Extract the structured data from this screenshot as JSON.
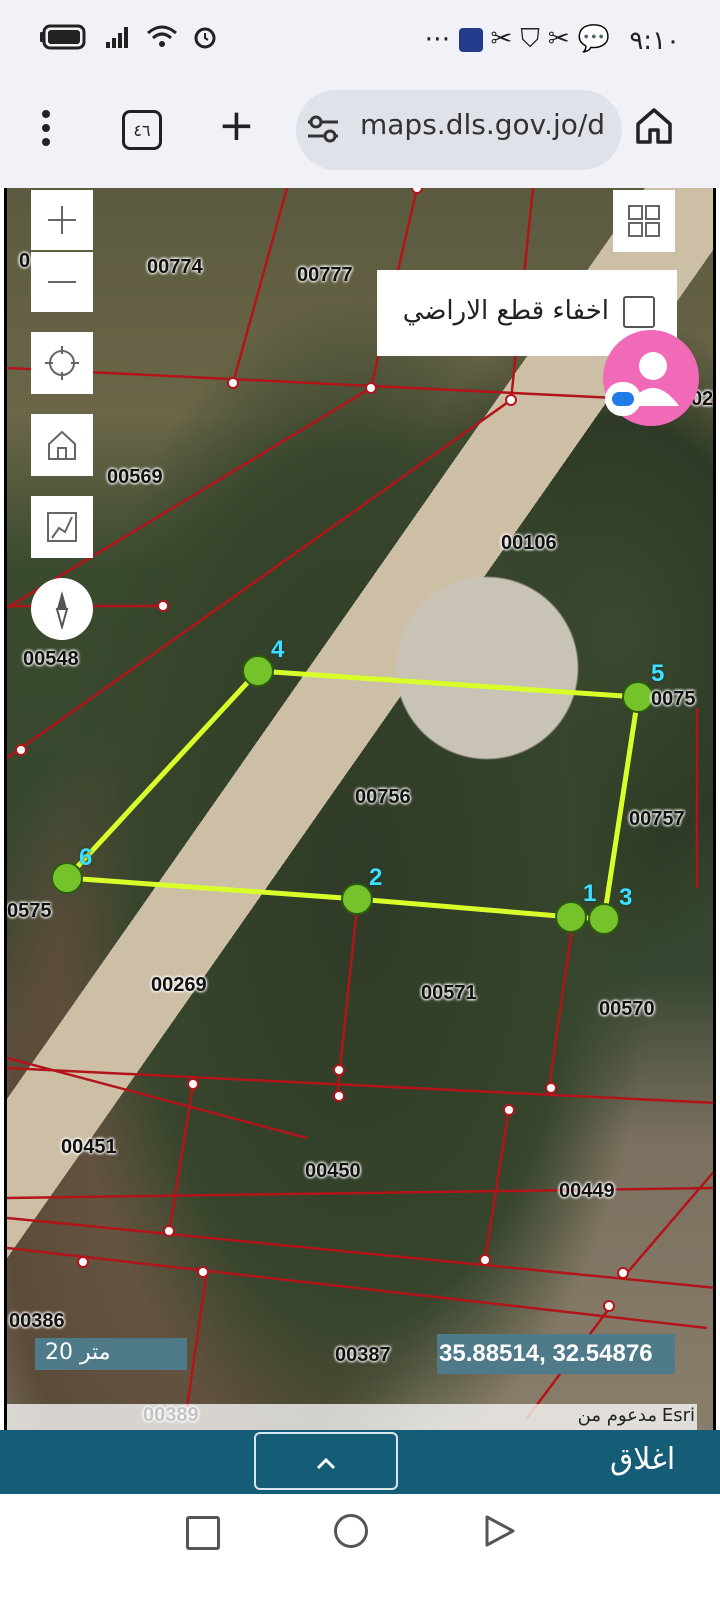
{
  "status_bar": {
    "time": "٩:١٠",
    "left_icons": [
      "battery-icon",
      "signal-icon",
      "wifi-icon",
      "alarm-icon"
    ],
    "right_icons": [
      "more-dots-icon",
      "app-icon",
      "tools-icon",
      "shield-icon",
      "tools-icon",
      "chat-icon"
    ]
  },
  "browser": {
    "tab_count": "٤٦",
    "url": "maps.dls.gov.jo/d"
  },
  "map": {
    "hide_parcels_label": "اخفاء قطع الاراضي",
    "coordinates": "35.88514, 32.54876",
    "scale_label": "20 متر",
    "attribution": "Esri",
    "attribution_prefix": "مدعوم من",
    "parcels": [
      {
        "id": "00774"
      },
      {
        "id": "00777"
      },
      {
        "id": "00569"
      },
      {
        "id": "00106"
      },
      {
        "id": "00548"
      },
      {
        "id": "00756"
      },
      {
        "id": "00757"
      },
      {
        "id": "0075"
      },
      {
        "id": "0575"
      },
      {
        "id": "00269"
      },
      {
        "id": "00571"
      },
      {
        "id": "00570"
      },
      {
        "id": "00451"
      },
      {
        "id": "00450"
      },
      {
        "id": "00449"
      },
      {
        "id": "00386"
      },
      {
        "id": "00387"
      },
      {
        "id": "00389"
      },
      {
        "id": "02"
      },
      {
        "id": "0"
      }
    ],
    "vertices": [
      "1",
      "2",
      "3",
      "4",
      "5",
      "6"
    ]
  },
  "panel": {
    "close_label": "اغلاق"
  },
  "colors": {
    "accent": "#155c76",
    "polygon": "#d8ff2a",
    "parcel_line": "#b3141a",
    "vertex_label": "#3fe0ff"
  }
}
